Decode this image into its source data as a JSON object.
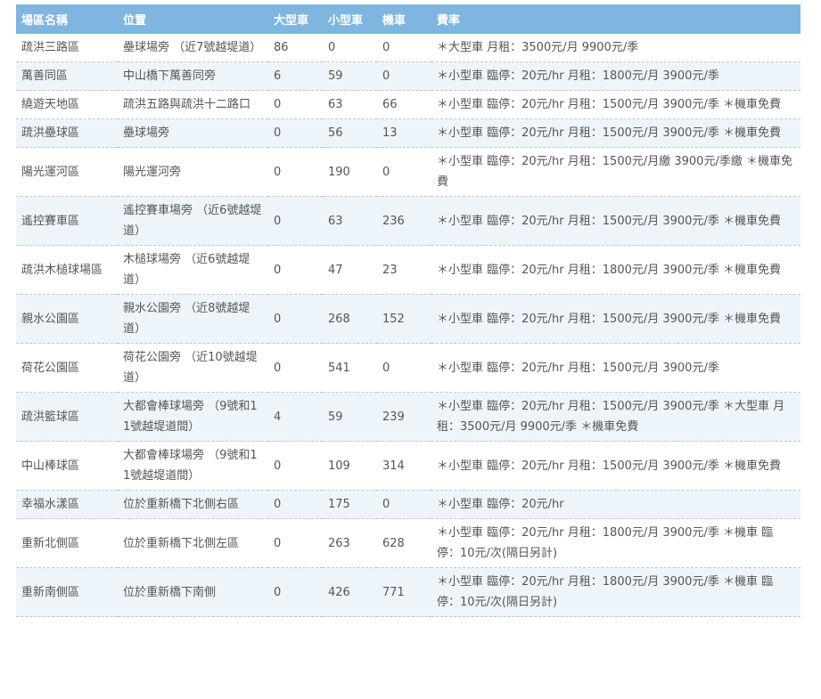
{
  "headers": {
    "name": "場區名稱",
    "location": "位置",
    "large": "大型車",
    "small": "小型車",
    "moto": "機車",
    "fee": "費率"
  },
  "rows": [
    {
      "name": "疏洪三路區",
      "location": "壘球場旁 （近7號越堤道）",
      "large": "86",
      "small": "0",
      "moto": "0",
      "fee": "＊大型車 月租：3500元/月 9900元/季"
    },
    {
      "name": "萬善同區",
      "location": "中山橋下萬善同旁",
      "large": "6",
      "small": "59",
      "moto": "0",
      "fee": "＊小型車 臨停：20元/hr 月租：1800元/月 3900元/季"
    },
    {
      "name": "繞遊天地區",
      "location": "疏洪五路與疏洪十二路口",
      "large": "0",
      "small": "63",
      "moto": "66",
      "fee": "＊小型車 臨停：20元/hr 月租：1500元/月 3900元/季 ＊機車免費"
    },
    {
      "name": "疏洪壘球區",
      "location": "壘球場旁",
      "large": "0",
      "small": "56",
      "moto": "13",
      "fee": "＊小型車 臨停：20元/hr 月租：1500元/月 3900元/季 ＊機車免費"
    },
    {
      "name": "陽光運河區",
      "location": "陽光運河旁",
      "large": "0",
      "small": "190",
      "moto": "0",
      "fee": "＊小型車 臨停：20元/hr 月租：1500元/月繳 3900元/季繳 ＊機車免費"
    },
    {
      "name": "遙控賽車區",
      "location": "遙控賽車場旁 （近6號越堤道）",
      "large": "0",
      "small": "63",
      "moto": "236",
      "fee": "＊小型車 臨停：20元/hr 月租：1500元/月 3900元/季 ＊機車免費"
    },
    {
      "name": "疏洪木槌球場區",
      "location": "木槌球場旁 （近6號越堤道）",
      "large": "0",
      "small": "47",
      "moto": "23",
      "fee": "＊小型車 臨停：20元/hr 月租：1800元/月 3900元/季 ＊機車免費"
    },
    {
      "name": "親水公園區",
      "location": "親水公園旁 （近8號越堤道）",
      "large": "0",
      "small": "268",
      "moto": "152",
      "fee": "＊小型車 臨停：20元/hr 月租：1500元/月 3900元/季 ＊機車免費"
    },
    {
      "name": "荷花公園區",
      "location": "荷花公園旁 （近10號越堤道）",
      "large": "0",
      "small": "541",
      "moto": "0",
      "fee": "＊小型車 臨停：20元/hr 月租：1500元/月 3900元/季"
    },
    {
      "name": "疏洪籃球區",
      "location": "大都會棒球場旁 （9號和11號越堤道間）",
      "large": "4",
      "small": "59",
      "moto": "239",
      "fee": "＊小型車 臨停：20元/hr 月租：1500元/月 3900元/季 ＊大型車 月租：3500元/月 9900元/季 ＊機車免費"
    },
    {
      "name": "中山棒球區",
      "location": "大都會棒球場旁 （9號和11號越堤道間）",
      "large": "0",
      "small": "109",
      "moto": "314",
      "fee": "＊小型車 臨停：20元/hr 月租：1500元/月 3900元/季 ＊機車免費"
    },
    {
      "name": "幸福水漾區",
      "location": "位於重新橋下北側右區",
      "large": "0",
      "small": "175",
      "moto": "0",
      "fee": "＊小型車 臨停：20元/hr"
    },
    {
      "name": "重新北側區",
      "location": "位於重新橋下北側左區",
      "large": "0",
      "small": "263",
      "moto": "628",
      "fee": "＊小型車 臨停：20元/hr 月租：1800元/月 3900元/季 ＊機車 臨停：10元/次(隔日另計)"
    },
    {
      "name": "重新南側區",
      "location": "位於重新橋下南側",
      "large": "0",
      "small": "426",
      "moto": "771",
      "fee": "＊小型車 臨停：20元/hr 月租：1800元/月 3900元/季 ＊機車 臨停：10元/次(隔日另計)"
    }
  ]
}
